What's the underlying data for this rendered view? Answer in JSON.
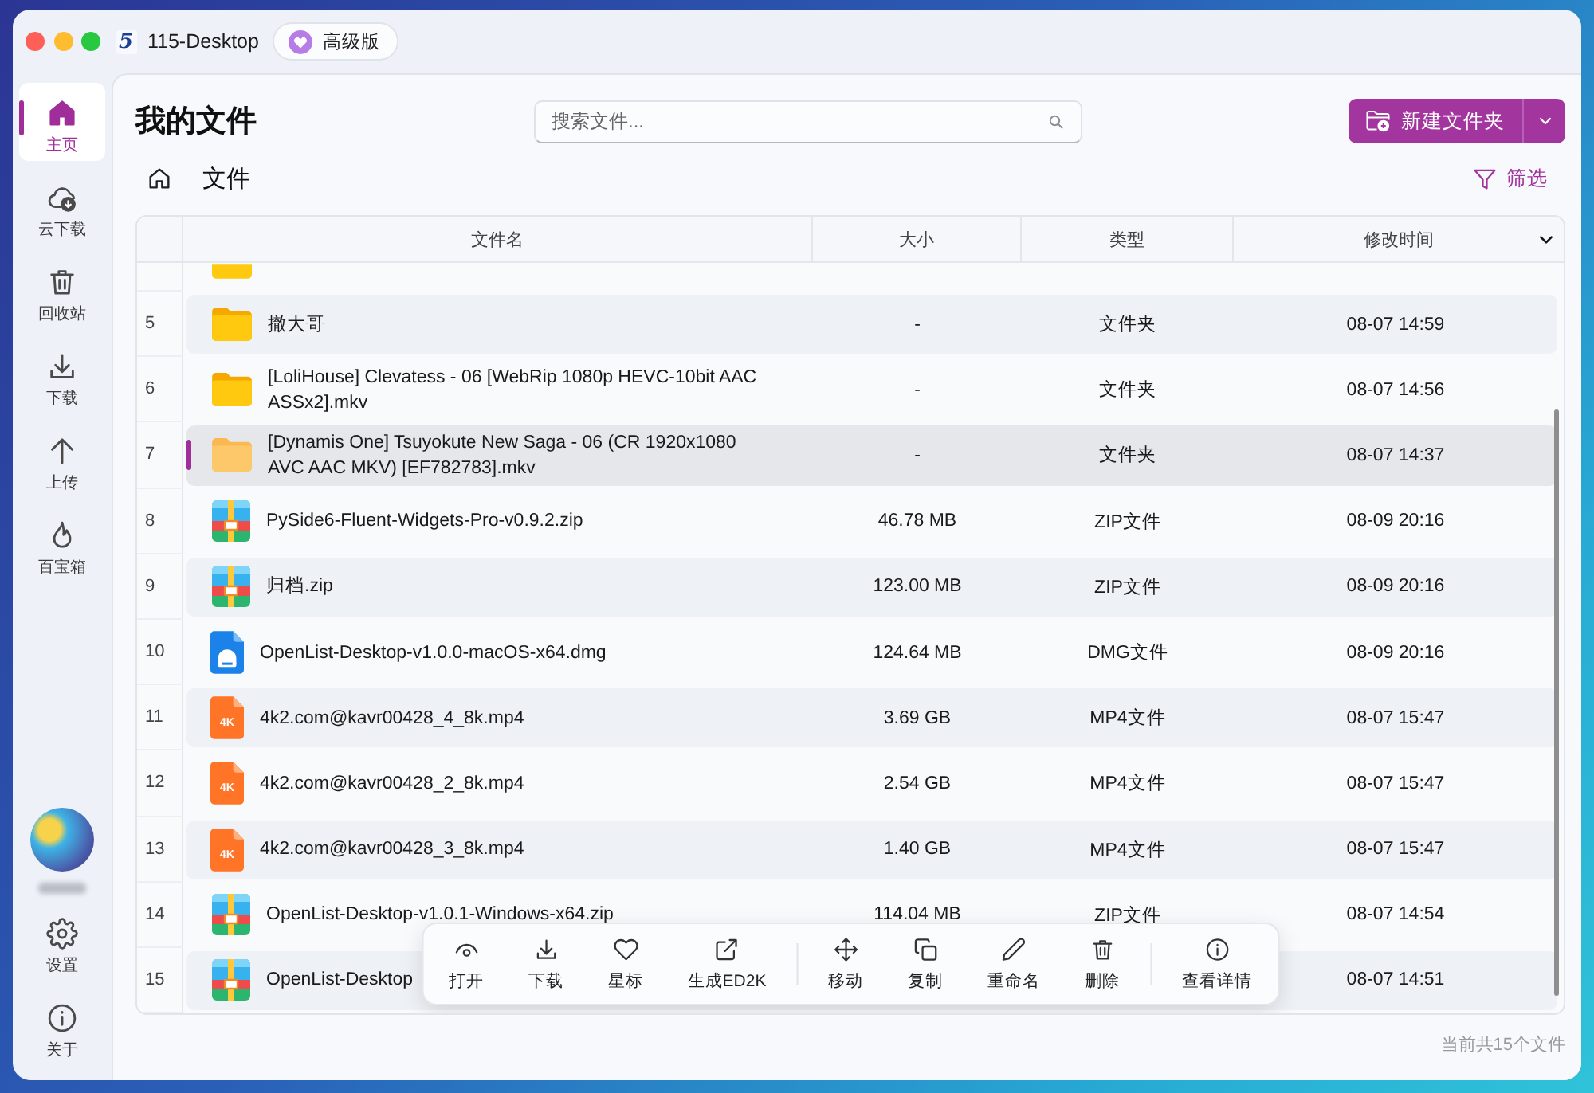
{
  "window": {
    "logo_mark": "5",
    "title": "115-Desktop",
    "plan_badge": "高级版"
  },
  "sidebar": {
    "items": [
      {
        "kind": "home",
        "label": "主页",
        "selected": true
      },
      {
        "kind": "cloud",
        "label": "云下载",
        "selected": false
      },
      {
        "kind": "trash",
        "label": "回收站",
        "selected": false
      },
      {
        "kind": "download",
        "label": "下载",
        "selected": false
      },
      {
        "kind": "upload",
        "label": "上传",
        "selected": false
      },
      {
        "kind": "flame",
        "label": "百宝箱",
        "selected": false
      }
    ],
    "bottom_items": [
      {
        "kind": "settings",
        "label": "设置",
        "selected": false
      },
      {
        "kind": "info",
        "label": "关于",
        "selected": false
      }
    ]
  },
  "header": {
    "title": "我的文件",
    "search": {
      "placeholder": "搜索文件..."
    },
    "new_folder_button": "新建文件夹"
  },
  "breadcrumb": [
    "文件"
  ],
  "filter_button": "筛选",
  "table": {
    "columns": [
      "文件名",
      "大小",
      "类型",
      "修改时间"
    ],
    "partial_row": {
      "kind": "folder"
    },
    "rows": [
      {
        "index": "5",
        "kind": "folder",
        "name": "撤大哥",
        "size": "-",
        "type": "文件夹",
        "modified": "08-07 14:59",
        "selected": false
      },
      {
        "index": "6",
        "kind": "folder",
        "name": "[LoliHouse] Clevatess - 06 [WebRip 1080p HEVC-10bit AAC ASSx2].mkv",
        "size": "-",
        "type": "文件夹",
        "modified": "08-07 14:56",
        "selected": false
      },
      {
        "index": "7",
        "kind": "folder",
        "name": "[Dynamis One] Tsuyokute New Saga - 06 (CR 1920x1080 AVC AAC MKV) [EF782783].mkv",
        "size": "-",
        "type": "文件夹",
        "modified": "08-07 14:37",
        "selected": true
      },
      {
        "index": "8",
        "kind": "zip",
        "name": "PySide6-Fluent-Widgets-Pro-v0.9.2.zip",
        "size": "46.78 MB",
        "type": "ZIP文件",
        "modified": "08-09 20:16",
        "selected": false
      },
      {
        "index": "9",
        "kind": "zip",
        "name": "归档.zip",
        "size": "123.00 MB",
        "type": "ZIP文件",
        "modified": "08-09 20:16",
        "selected": false
      },
      {
        "index": "10",
        "kind": "dmg",
        "name": "OpenList-Desktop-v1.0.0-macOS-x64.dmg",
        "size": "124.64 MB",
        "type": "DMG文件",
        "modified": "08-09 20:16",
        "selected": false
      },
      {
        "index": "11",
        "kind": "video",
        "badge": "4K",
        "name": "4k2.com@kavr00428_4_8k.mp4",
        "size": "3.69 GB",
        "type": "MP4文件",
        "modified": "08-07 15:47",
        "selected": false
      },
      {
        "index": "12",
        "kind": "video",
        "badge": "4K",
        "name": "4k2.com@kavr00428_2_8k.mp4",
        "size": "2.54 GB",
        "type": "MP4文件",
        "modified": "08-07 15:47",
        "selected": false
      },
      {
        "index": "13",
        "kind": "video",
        "badge": "4K",
        "name": "4k2.com@kavr00428_3_8k.mp4",
        "size": "1.40 GB",
        "type": "MP4文件",
        "modified": "08-07 15:47",
        "selected": false
      },
      {
        "index": "14",
        "kind": "zip",
        "name": "OpenList-Desktop-v1.0.1-Windows-x64.zip",
        "size": "114.04 MB",
        "type": "ZIP文件",
        "modified": "08-07 14:54",
        "selected": false
      },
      {
        "index": "15",
        "kind": "zip",
        "name": "OpenList-Desktop",
        "modified": "08-07 14:51",
        "selected": false
      }
    ]
  },
  "action_bar": {
    "groups": [
      [
        {
          "kind": "eye",
          "label": "打开"
        },
        {
          "kind": "download",
          "label": "下载"
        },
        {
          "kind": "heart",
          "label": "星标"
        },
        {
          "kind": "link",
          "label": "生成ED2K"
        }
      ],
      [
        {
          "kind": "move",
          "label": "移动"
        },
        {
          "kind": "copy",
          "label": "复制"
        },
        {
          "kind": "pencil",
          "label": "重命名"
        },
        {
          "kind": "trash",
          "label": "删除"
        }
      ],
      [
        {
          "kind": "info",
          "label": "查看详情"
        }
      ]
    ]
  },
  "status_bar": "当前共15个文件"
}
